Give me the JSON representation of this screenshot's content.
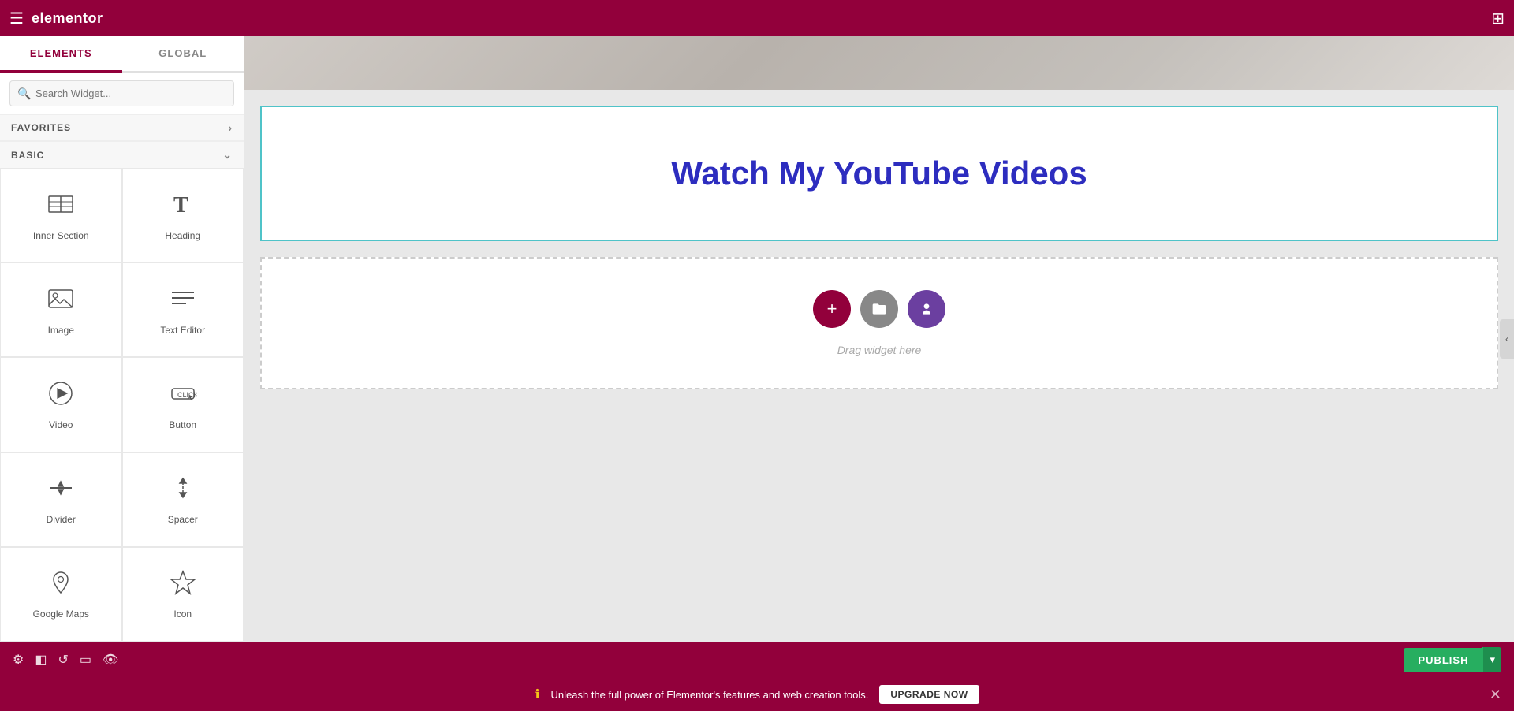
{
  "topbar": {
    "logo": "elementor",
    "hamburger_icon": "☰",
    "grid_icon": "⊞"
  },
  "sidebar": {
    "tab_elements": "ELEMENTS",
    "tab_global": "GLOBAL",
    "search_placeholder": "Search Widget...",
    "favorites_label": "FAVORITES",
    "basic_label": "BASIC",
    "widgets": [
      {
        "id": "inner-section",
        "label": "Inner Section",
        "icon": "inner-section-icon"
      },
      {
        "id": "heading",
        "label": "Heading",
        "icon": "heading-icon"
      },
      {
        "id": "image",
        "label": "Image",
        "icon": "image-icon"
      },
      {
        "id": "text-editor",
        "label": "Text Editor",
        "icon": "text-editor-icon"
      },
      {
        "id": "video",
        "label": "Video",
        "icon": "video-icon"
      },
      {
        "id": "button",
        "label": "Button",
        "icon": "button-icon"
      },
      {
        "id": "divider",
        "label": "Divider",
        "icon": "divider-icon"
      },
      {
        "id": "spacer",
        "label": "Spacer",
        "icon": "spacer-icon"
      },
      {
        "id": "google-maps",
        "label": "Google Maps",
        "icon": "google-maps-icon"
      },
      {
        "id": "icon",
        "label": "Icon",
        "icon": "icon-widget-icon"
      }
    ]
  },
  "canvas": {
    "heading_text": "Watch My YouTube Videos",
    "drop_zone_text": "Drag widget here",
    "add_btn_label": "+",
    "folder_btn_label": "📁",
    "template_btn_label": "👤"
  },
  "bottom_bar": {
    "publish_label": "PUBLISH",
    "settings_icon": "⚙",
    "layers_icon": "◧",
    "history_icon": "↺",
    "responsive_icon": "▭",
    "eye_icon": "👁"
  },
  "notif_bar": {
    "icon": "ℹ",
    "message": "Unleash the full power of Elementor's features and web creation tools.",
    "upgrade_label": "UPGRADE NOW",
    "close_icon": "✕"
  },
  "colors": {
    "brand": "#92003b",
    "accent_blue": "#2d2dbf",
    "border_teal": "#4fc3c8",
    "green": "#27ae60",
    "purple": "#6b3fa0",
    "gray_btn": "#888888"
  }
}
